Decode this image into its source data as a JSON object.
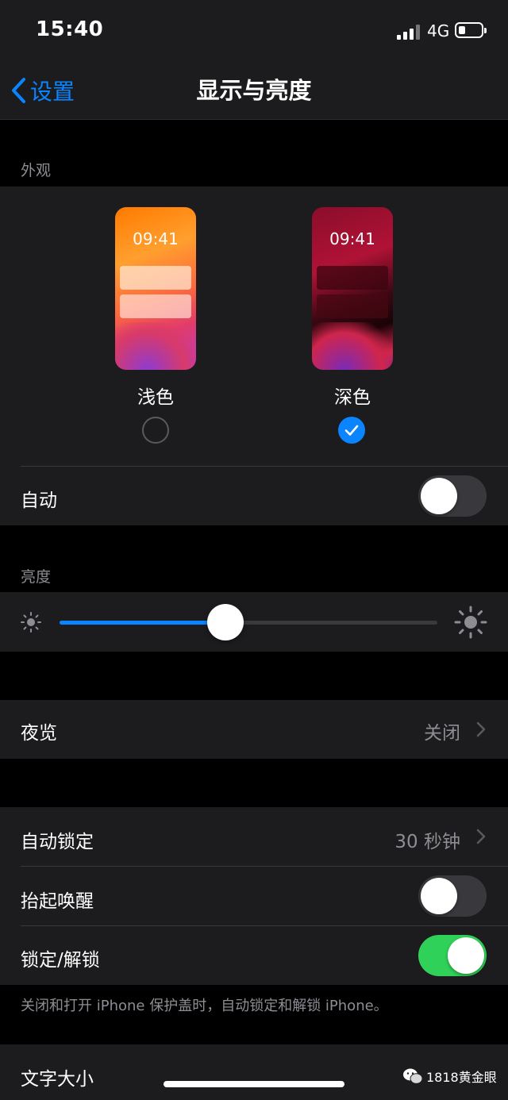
{
  "status": {
    "time": "15:40",
    "network": "4G",
    "battery_icon": "battery-icon",
    "signal_icon": "signal-icon"
  },
  "nav": {
    "back_label": "设置",
    "title": "显示与亮度"
  },
  "appearance": {
    "header": "外观",
    "options": [
      {
        "label": "浅色",
        "preview_time": "09:41",
        "selected": false
      },
      {
        "label": "深色",
        "preview_time": "09:41",
        "selected": true
      }
    ],
    "auto_label": "自动",
    "auto_on": false
  },
  "brightness": {
    "header": "亮度",
    "level": 0.44
  },
  "night_shift": {
    "label": "夜览",
    "value": "关闭"
  },
  "lock": {
    "auto_lock_label": "自动锁定",
    "auto_lock_value": "30 秒钟",
    "raise_label": "抬起唤醒",
    "raise_on": false,
    "lock_unlock_label": "锁定/解锁",
    "lock_unlock_on": true,
    "footnote": "关闭和打开 iPhone 保护盖时，自动锁定和解锁 iPhone。"
  },
  "text_size": {
    "label": "文字大小"
  },
  "watermark": {
    "text": "1818黄金眼"
  },
  "colors": {
    "accent": "#0a84ff",
    "toggle_on": "#30d158",
    "toggle_off": "#39393d",
    "cell": "#1c1c1e"
  }
}
